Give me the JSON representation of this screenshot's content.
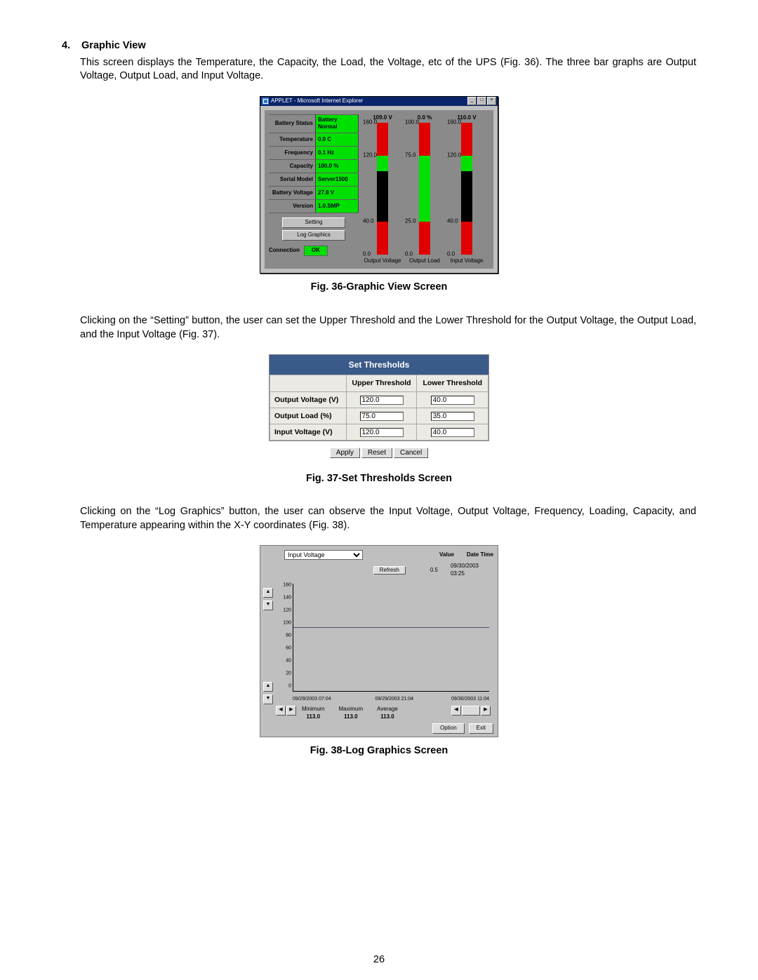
{
  "section": {
    "number": "4.",
    "title": "Graphic View",
    "para1": "This screen displays the Temperature, the Capacity, the Load, the Voltage, etc of the UPS (Fig. 36).  The three bar graphs are Output Voltage, Output Load, and Input Voltage.",
    "para2": "Clicking on the “Setting” button, the user can set the Upper Threshold and the Lower Threshold for the Output Voltage, the Output Load, and the Input Voltage (Fig. 37).",
    "para3": "Clicking on the “Log Graphics” button, the user can observe the Input Voltage, Output Voltage, Frequency, Loading, Capacity, and Temperature appearing within the X-Y coordinates (Fig. 38)."
  },
  "captions": {
    "fig36": "Fig. 36-Graphic View Screen",
    "fig37": "Fig. 37-Set Thresholds Screen",
    "fig38": "Fig. 38-Log Graphics Screen"
  },
  "page_number": "26",
  "win_title": "APPLET - Microsoft Internet Explorer",
  "info_rows": {
    "battery_status": {
      "k": "Battery Status",
      "v": "Battery Normal"
    },
    "temperature": {
      "k": "Temperature",
      "v": "0.0 C"
    },
    "frequency": {
      "k": "Frequency",
      "v": "0.1 Hz"
    },
    "capacity": {
      "k": "Capacity",
      "v": "100.0 %"
    },
    "serial_model": {
      "k": "Serial Model",
      "v": "Server1500"
    },
    "battery_voltage": {
      "k": "Battery Voltage",
      "v": "27.8 V"
    },
    "version": {
      "k": "Version",
      "v": "1.0.SMP"
    }
  },
  "buttons": {
    "setting": "Setting",
    "log_graphics": "Log Graphics",
    "connection_lbl": "Connection",
    "connection_val": "OK"
  },
  "bar_ticks": [
    "160.0",
    "120.0",
    "40.0",
    "0.0"
  ],
  "bar_ticks_load": [
    "100.0",
    "75.0",
    "25.0",
    "0.0"
  ],
  "bars": {
    "output_voltage": {
      "title": "109.0 V",
      "bottom_label": "Output Voltage",
      "upper_pct": 25.0,
      "lower_pct": 25.0,
      "green_top_pct": 25.0,
      "green_bot_pct": 25.0
    },
    "output_load": {
      "title": "0.0 %",
      "bottom_label": "Output Load",
      "upper_pct": 25.0,
      "lower_pct": 25.0,
      "green_top_pct": 25.0,
      "green_bot_pct": 25.0
    },
    "input_voltage": {
      "title": "110.0 V",
      "bottom_label": "Input Voltage",
      "upper_pct": 25.0,
      "lower_pct": 25.0,
      "green_top_pct": 25.0,
      "green_bot_pct": 25.0
    }
  },
  "thresholds": {
    "title": "Set Thresholds",
    "headers": {
      "col1": "",
      "upper": "Upper Threshold",
      "lower": "Lower Threshold"
    },
    "rows": [
      {
        "k": "Output Voltage (V)",
        "u": "120.0",
        "l": "40.0"
      },
      {
        "k": "Output Load (%)",
        "u": "75.0",
        "l": "35.0"
      },
      {
        "k": "Input Voltage (V)",
        "u": "120.0",
        "l": "40.0"
      }
    ],
    "btn_apply": "Apply",
    "btn_reset": "Reset",
    "btn_cancel": "Cancel"
  },
  "log": {
    "dropdown_value": "Input Voltage",
    "h_value": "Value",
    "h_datetime": "Date Time",
    "refresh": "Refresh",
    "value": "0.5",
    "datetime": "09/30/2003 03:25",
    "yticks": [
      "160",
      "140",
      "120",
      "100",
      "80",
      "60",
      "40",
      "20",
      "0"
    ],
    "xlabels": [
      "09/29/2003 07:04",
      "09/29/2003 21:04",
      "09/30/2003 11:04"
    ],
    "stats": {
      "min_lbl": "Minimum",
      "min_val": "113.0",
      "max_lbl": "Maximum",
      "max_val": "113.0",
      "avg_lbl": "Average",
      "avg_val": "113.0"
    },
    "btn_option": "Option",
    "btn_exit": "Exit"
  },
  "chart_data": [
    {
      "type": "bar",
      "title": "UPS Graphic View",
      "bars": [
        {
          "label": "Output Voltage",
          "current": 109.0,
          "min": 0.0,
          "max": 160.0,
          "upper_threshold": 120.0,
          "lower_threshold": 40.0,
          "unit": "V"
        },
        {
          "label": "Output Load",
          "current": 0.0,
          "min": 0.0,
          "max": 100.0,
          "upper_threshold": 75.0,
          "lower_threshold": 25.0,
          "unit": "%"
        },
        {
          "label": "Input Voltage",
          "current": 110.0,
          "min": 0.0,
          "max": 160.0,
          "upper_threshold": 120.0,
          "lower_threshold": 40.0,
          "unit": "V"
        }
      ]
    },
    {
      "type": "line",
      "title": "Log Graphics – Input Voltage",
      "ylabel": "Input Voltage",
      "ylim": [
        0,
        160
      ],
      "x_end_labels": [
        "09/29/2003 07:04",
        "09/29/2003 21:04",
        "09/30/2003 11:04"
      ],
      "series": [
        {
          "name": "Input Voltage",
          "values_flat_at": 113.0,
          "min": 113.0,
          "max": 113.0,
          "avg": 113.0,
          "latest_value": 0.5,
          "latest_time": "09/30/2003 03:25"
        }
      ]
    }
  ]
}
